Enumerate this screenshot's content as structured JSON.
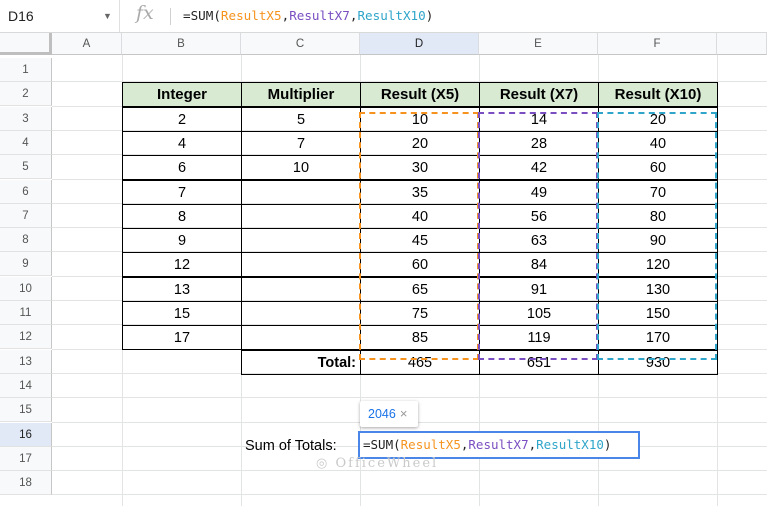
{
  "formula_bar": {
    "name_box": "D16",
    "fx_label": "fx",
    "formula_parts": [
      {
        "text": "=SUM(",
        "color": "dark"
      },
      {
        "text": "ResultX5",
        "color": "orange"
      },
      {
        "text": ",",
        "color": "dark"
      },
      {
        "text": "ResultX7",
        "color": "purple"
      },
      {
        "text": ",",
        "color": "dark"
      },
      {
        "text": "ResultX10",
        "color": "cyan"
      },
      {
        "text": ")",
        "color": "dark"
      }
    ]
  },
  "columns": [
    "A",
    "B",
    "C",
    "D",
    "E",
    "F"
  ],
  "rows": [
    "1",
    "2",
    "3",
    "4",
    "5",
    "6",
    "7",
    "8",
    "9",
    "10",
    "11",
    "12",
    "13",
    "14",
    "15",
    "16",
    "17",
    "18"
  ],
  "selected_column": "D",
  "selected_row": "16",
  "table": {
    "headers": [
      "Integer",
      "Multiplier",
      "Result (X5)",
      "Result (X7)",
      "Result (X10)"
    ],
    "integers": [
      "2",
      "4",
      "6",
      "7",
      "8",
      "9",
      "12",
      "13",
      "15",
      "17"
    ],
    "multipliers": [
      "5",
      "7",
      "10",
      "",
      "",
      "",
      "",
      "",
      "",
      ""
    ],
    "x5": [
      "10",
      "20",
      "30",
      "35",
      "40",
      "45",
      "60",
      "65",
      "75",
      "85"
    ],
    "x7": [
      "14",
      "28",
      "42",
      "49",
      "56",
      "63",
      "84",
      "91",
      "105",
      "119"
    ],
    "x10": [
      "20",
      "40",
      "60",
      "70",
      "80",
      "90",
      "120",
      "130",
      "150",
      "170"
    ],
    "total_label": "Total:",
    "totals": [
      "465",
      "651",
      "930"
    ]
  },
  "sum_label": "Sum of Totals:",
  "preview_value": "2046",
  "preview_close": "×",
  "watermark": "OfficeWheel",
  "colors": {
    "header_fill": "#d9ead3",
    "orange": "#f6931e",
    "purple": "#7a4ec1",
    "cyan": "#2fa5c9",
    "selection": "#4a86e8"
  }
}
